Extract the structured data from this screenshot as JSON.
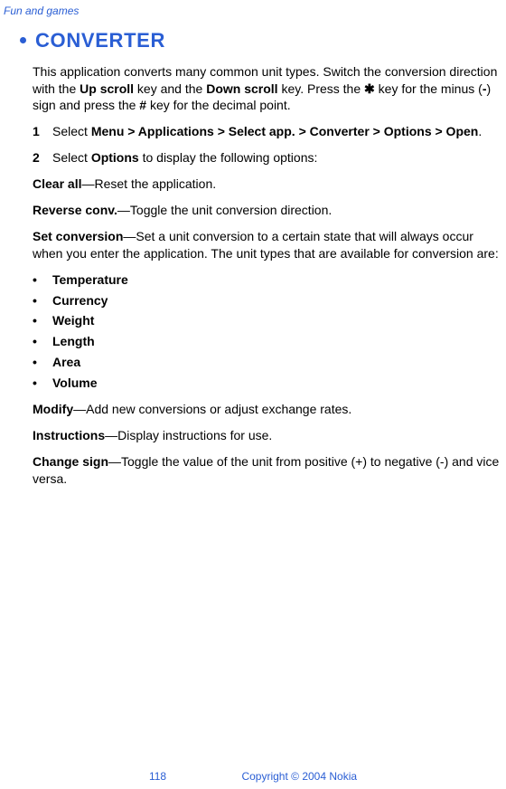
{
  "header": {
    "running_head": "Fun and games"
  },
  "heading": {
    "title": "CONVERTER"
  },
  "intro": {
    "t1": "This application converts many common unit types. Switch the conversion direction with the ",
    "b1": "Up scroll",
    "t2": " key and the ",
    "b2": "Down scroll",
    "t3": " key. Press the ",
    "star": "✱",
    "t4": " key for the minus (",
    "b3": "-",
    "t5": ") sign and press the ",
    "b4": "#",
    "t6": " key for the decimal point."
  },
  "steps": {
    "s1": {
      "num": "1",
      "t1": "Select ",
      "b1": "Menu > Applications > Select app. > Converter > Options > Open",
      "t2": "."
    },
    "s2": {
      "num": "2",
      "t1": "Select ",
      "b1": "Options",
      "t2": " to display the following options:"
    }
  },
  "options": {
    "clear": {
      "b": "Clear all",
      "t": "—Reset the application."
    },
    "reverse": {
      "b": "Reverse conv.",
      "t": "—Toggle the unit conversion direction."
    },
    "setconv": {
      "b": "Set conversion",
      "t": "—Set a unit conversion to a certain state that will always occur when you enter the application. The unit types that are available for conversion are:"
    }
  },
  "unit_types": {
    "items": [
      "Temperature",
      "Currency",
      "Weight",
      "Length",
      "Area",
      "Volume"
    ]
  },
  "more": {
    "modify": {
      "b": "Modify",
      "t": "—Add new conversions or adjust exchange rates."
    },
    "instructions": {
      "b": "Instructions",
      "t": "—Display instructions for use."
    },
    "changesign": {
      "b": "Change sign",
      "t": "—Toggle the value of the unit from positive (+) to negative (-) and vice versa."
    }
  },
  "footer": {
    "page": "118",
    "copyright": "Copyright © 2004 Nokia"
  }
}
